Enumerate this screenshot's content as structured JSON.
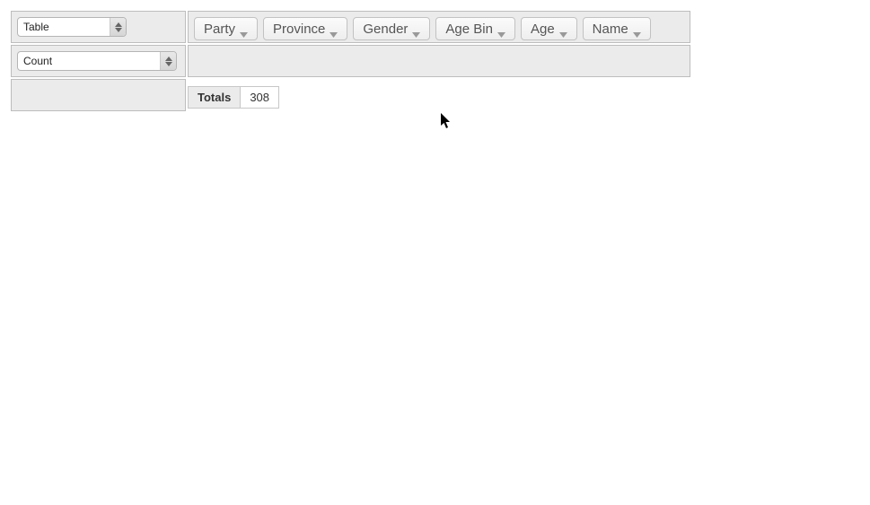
{
  "renderer": {
    "selected": "Table"
  },
  "aggregator": {
    "selected": "Count"
  },
  "unused_attrs": [
    {
      "label": "Party"
    },
    {
      "label": "Province"
    },
    {
      "label": "Gender"
    },
    {
      "label": "Age Bin"
    },
    {
      "label": "Age"
    },
    {
      "label": "Name"
    }
  ],
  "result": {
    "totals_label": "Totals",
    "totals_value": "308"
  }
}
